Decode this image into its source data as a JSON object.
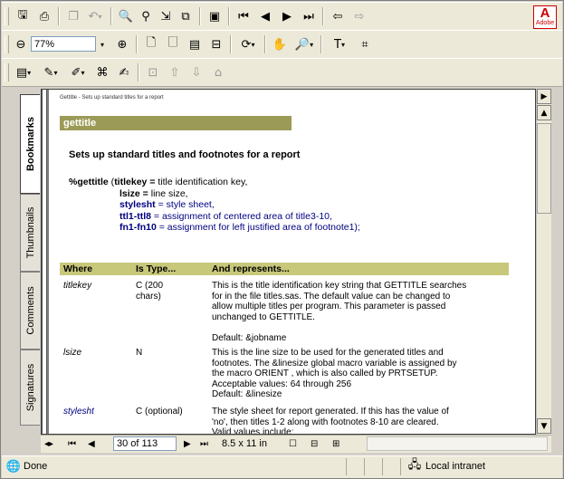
{
  "toolbar1": {
    "icons": [
      "save-icon",
      "print-icon",
      "copy-icon",
      "undo-icon",
      "find-icon",
      "search-icon",
      "select-icon",
      "bookmark-icon",
      "first-page-icon",
      "previous-page-icon",
      "next-page-icon",
      "last-page-icon",
      "back-icon",
      "forward-icon"
    ],
    "adobe_label": "Adobe"
  },
  "toolbar2": {
    "zoom_value": "77%"
  },
  "side_tabs": [
    "Bookmarks",
    "Thumbnails",
    "Comments",
    "Signatures"
  ],
  "document": {
    "header_small": "Gettitle - Sets up standard titles for a report",
    "banner": "gettitle",
    "heading": "Sets up standard titles and footnotes for a report",
    "syntax": {
      "macro": "%gettitle",
      "lines": [
        {
          "key": "titlekey = ",
          "desc": "title identification key,"
        },
        {
          "key": "lsize = ",
          "desc": "line size,"
        },
        {
          "key": "stylesht",
          "desc": " = style sheet,"
        },
        {
          "key": "ttl1-ttl8",
          "desc": " = assignment of centered area of title3-10,"
        },
        {
          "key": "fn1-fn10",
          "desc": " = assignment for left justified area of footnote1);"
        }
      ]
    },
    "table": {
      "headers": [
        "Where",
        "Is Type...",
        "And represents..."
      ],
      "rows": [
        {
          "name": "titlekey",
          "type": [
            "C (200",
            "chars)"
          ],
          "desc": [
            "This is the title identification key string that GETTITLE searches",
            "for in the file titles.sas. The default value can be changed to",
            "allow multiple titles per program. This parameter is passed",
            "unchanged to GETTITLE.",
            "",
            "Default: &jobname"
          ]
        },
        {
          "name": "lsize",
          "type": [
            "N"
          ],
          "desc": [
            "This is the line size to be used for the generated titles and",
            "footnotes. The &linesize global macro variable is assigned by",
            "the macro ORIENT , which is also called by PRTSETUP.",
            "Acceptable values: 64 through 256",
            "Default: &linesize"
          ]
        },
        {
          "name": "stylesht",
          "type": [
            "C (optional)"
          ],
          "desc": [
            "The style sheet for report generated.  If this has the value of",
            "'no', then titles 1-2 along with footnotes 8-10 are cleared.",
            "Valid values include:"
          ]
        }
      ]
    }
  },
  "navbar": {
    "page_indicator": "30 of 113",
    "page_size": "8.5 x 11 in"
  },
  "statusbar": {
    "status": "Done",
    "zone": "Local intranet"
  }
}
